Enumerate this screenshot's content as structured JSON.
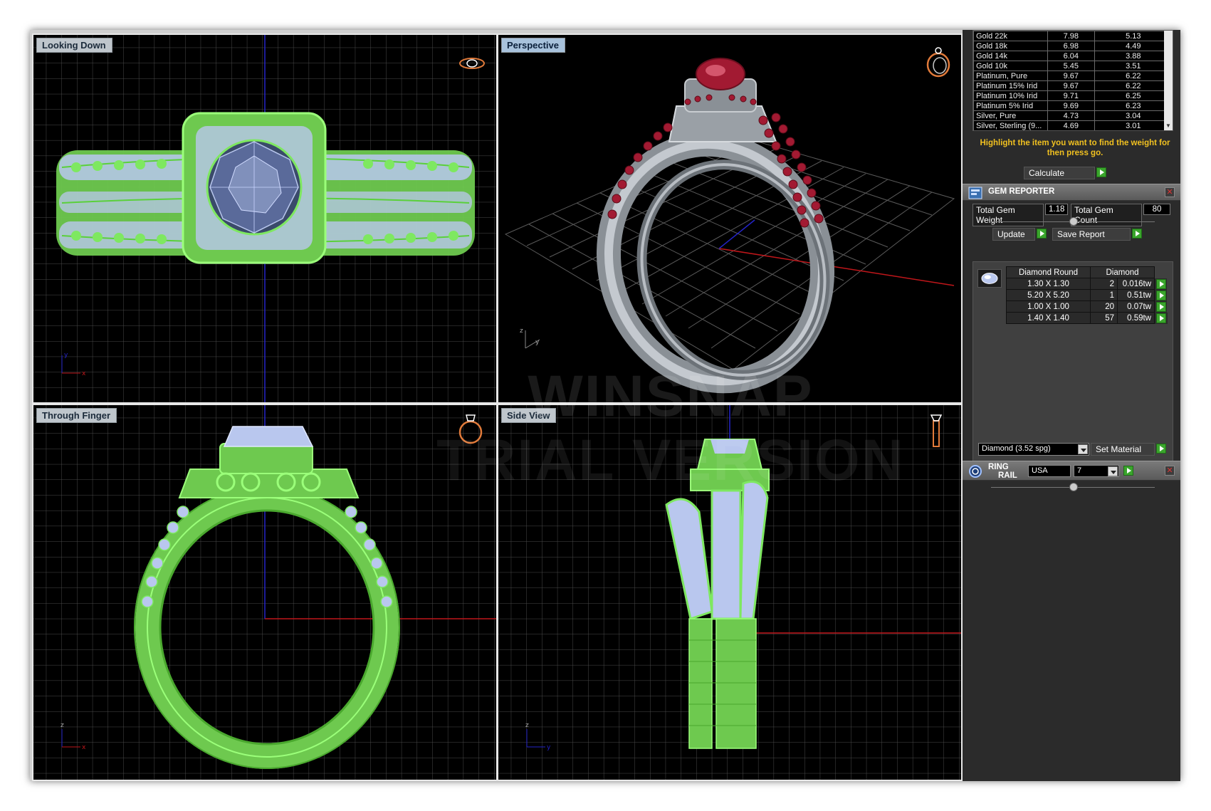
{
  "viewports": {
    "top_left": {
      "label": "Looking Down"
    },
    "top_right": {
      "label": "Perspective"
    },
    "bottom_left": {
      "label": "Through Finger"
    },
    "bottom_right": {
      "label": "Side View"
    }
  },
  "watermark": {
    "line1": "WINSNAP",
    "line2": "TRIAL VERSION"
  },
  "metal_table": {
    "rows": [
      [
        "Gold 22k",
        "7.98",
        "5.13"
      ],
      [
        "Gold 18k",
        "6.98",
        "4.49"
      ],
      [
        "Gold 14k",
        "6.04",
        "3.88"
      ],
      [
        "Gold 10k",
        "5.45",
        "3.51"
      ],
      [
        "Platinum, Pure",
        "9.67",
        "6.22"
      ],
      [
        "Platinum 15% Irid",
        "9.67",
        "6.22"
      ],
      [
        "Platinum 10% Irid",
        "9.71",
        "6.25"
      ],
      [
        "Platinum 5% Irid",
        "9.69",
        "6.23"
      ],
      [
        "Silver, Pure",
        "4.73",
        "3.04"
      ],
      [
        "Silver, Sterling (9...",
        "4.69",
        "3.01"
      ]
    ]
  },
  "hint_text": "Highlight the item you want to find the weight for then press go.",
  "calculate_label": "Calculate",
  "gem_reporter": {
    "title": "GEM REPORTER",
    "total_weight_label": "Total Gem Weight",
    "total_weight_value": "1.18",
    "total_count_label": "Total Gem Count",
    "total_count_value": "80",
    "update_label": "Update",
    "save_report_label": "Save Report",
    "table_header_shape": "Diamond Round",
    "table_header_material": "Diamond",
    "rows": [
      {
        "size": "1.30 X 1.30",
        "qty": "2",
        "tw": "0.016tw"
      },
      {
        "size": "5.20 X 5.20",
        "qty": "1",
        "tw": "0.51tw"
      },
      {
        "size": "1.00 X 1.00",
        "qty": "20",
        "tw": "0.07tw"
      },
      {
        "size": "1.40 X 1.40",
        "qty": "57",
        "tw": "0.59tw"
      }
    ],
    "material_select": "Diamond    (3.52 spg)",
    "set_material_label": "Set Material"
  },
  "ring_rail": {
    "title_line1": "RING",
    "title_line2": "RAIL",
    "region": "USA",
    "size": "7"
  },
  "colors": {
    "wire_green": "#7ee860",
    "gem_blue": "#b9c7ee",
    "ruby": "#a21a32",
    "metal_grey": "#9aa0a6",
    "axis_red": "#c0161a",
    "axis_blue": "#2424c8"
  }
}
